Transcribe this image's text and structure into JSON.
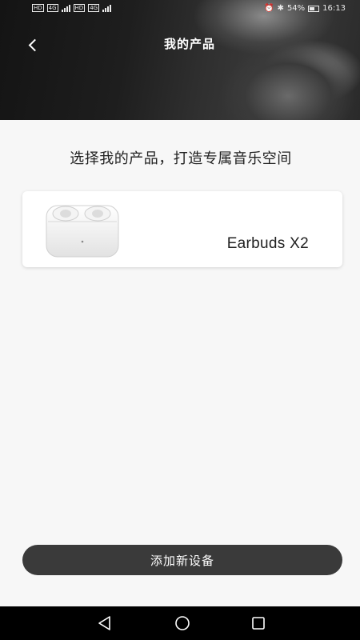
{
  "status_bar": {
    "left_tags": [
      "HD",
      "4G",
      "HD",
      "4G"
    ],
    "battery": "54%",
    "time": "16:13"
  },
  "header": {
    "title": "我的产品"
  },
  "main": {
    "subtitle": "选择我的产品，打造专属音乐空间",
    "products": [
      {
        "name": "Earbuds X2",
        "image_icon": "earbuds-case-icon"
      }
    ],
    "add_button_label": "添加新设备"
  },
  "nav_bar": {
    "icons": [
      "back-triangle-icon",
      "home-circle-icon",
      "recent-square-icon"
    ]
  },
  "colors": {
    "button_bg": "#3a3a3a",
    "page_bg": "#f7f7f7",
    "card_bg": "#ffffff",
    "nav_bg": "#000000"
  }
}
